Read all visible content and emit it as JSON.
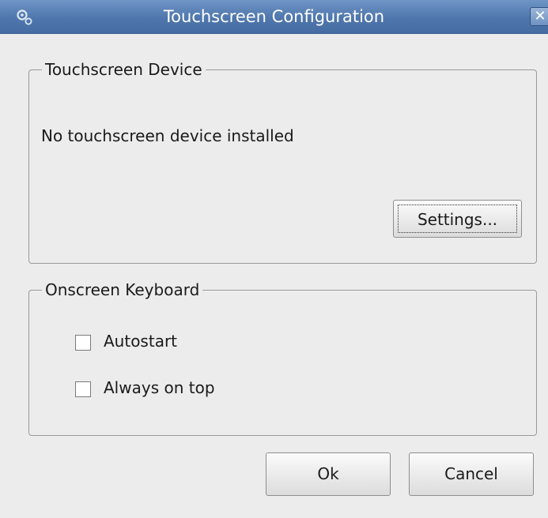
{
  "window": {
    "title": "Touchscreen Configuration",
    "close_glyph": "✕",
    "icon": "gears-icon"
  },
  "touchscreen_device": {
    "legend": "Touchscreen Device",
    "status": "No touchscreen device installed",
    "settings_label": "Settings..."
  },
  "onscreen_keyboard": {
    "legend": "Onscreen Keyboard",
    "options": [
      {
        "label": "Autostart",
        "checked": false
      },
      {
        "label": "Always on top",
        "checked": false
      }
    ]
  },
  "buttons": {
    "ok_label": "Ok",
    "cancel_label": "Cancel"
  },
  "colors": {
    "titlebar": "#4f77ad",
    "background": "#ececec"
  }
}
